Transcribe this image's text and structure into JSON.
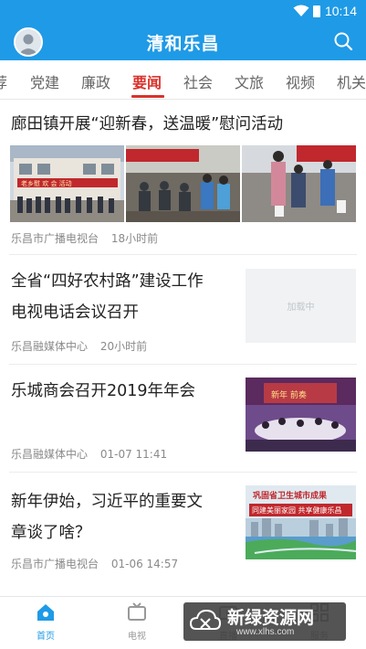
{
  "status": {
    "time": "10:14"
  },
  "app": {
    "title": "清和乐昌"
  },
  "tabs": [
    {
      "label": "荐"
    },
    {
      "label": "党建"
    },
    {
      "label": "廉政"
    },
    {
      "label": "要闻"
    },
    {
      "label": "社会"
    },
    {
      "label": "文旅"
    },
    {
      "label": "视频"
    },
    {
      "label": "机关"
    }
  ],
  "articles": [
    {
      "title": "廊田镇开展“迎新春，送温暖”慰问活动",
      "source": "乐昌市广播电视台",
      "time": "18小时前",
      "images": [
        {
          "sign": "老乡慰 欢 会 活动"
        },
        {
          "sign": ""
        },
        {
          "sign": ""
        }
      ]
    },
    {
      "title_lines": [
        "全省“四好农村路”建设工作",
        "电视电话会议召开"
      ],
      "source": "乐昌融媒体中心",
      "time": "20小时前",
      "thumb_text": "加载中"
    },
    {
      "title": "乐城商会召开2019年年会",
      "source": "乐昌融媒体中心",
      "time": "01-07 11:41",
      "thumb_text": "新年 前奏"
    },
    {
      "title_lines": [
        "新年伊始，习近平的重要文",
        "章谈了啥？"
      ],
      "source": "乐昌市广播电视台",
      "time": "01-06 14:57",
      "thumb_text": "巩固省卫生城市成果",
      "thumb_text2": "同建美丽家园 共享健康乐昌"
    }
  ],
  "bottom_nav": [
    {
      "label": "首页",
      "icon": "home-icon"
    },
    {
      "label": "电视",
      "icon": "tv-icon"
    },
    {
      "label": "直播",
      "icon": "live-icon"
    },
    {
      "label": "服务",
      "icon": "service-icon"
    }
  ],
  "watermark": {
    "text": "新绿资源网",
    "url": "www.xlhs.com"
  },
  "colors": {
    "brand": "#1f9ae6",
    "active_tab": "#d9322b"
  }
}
